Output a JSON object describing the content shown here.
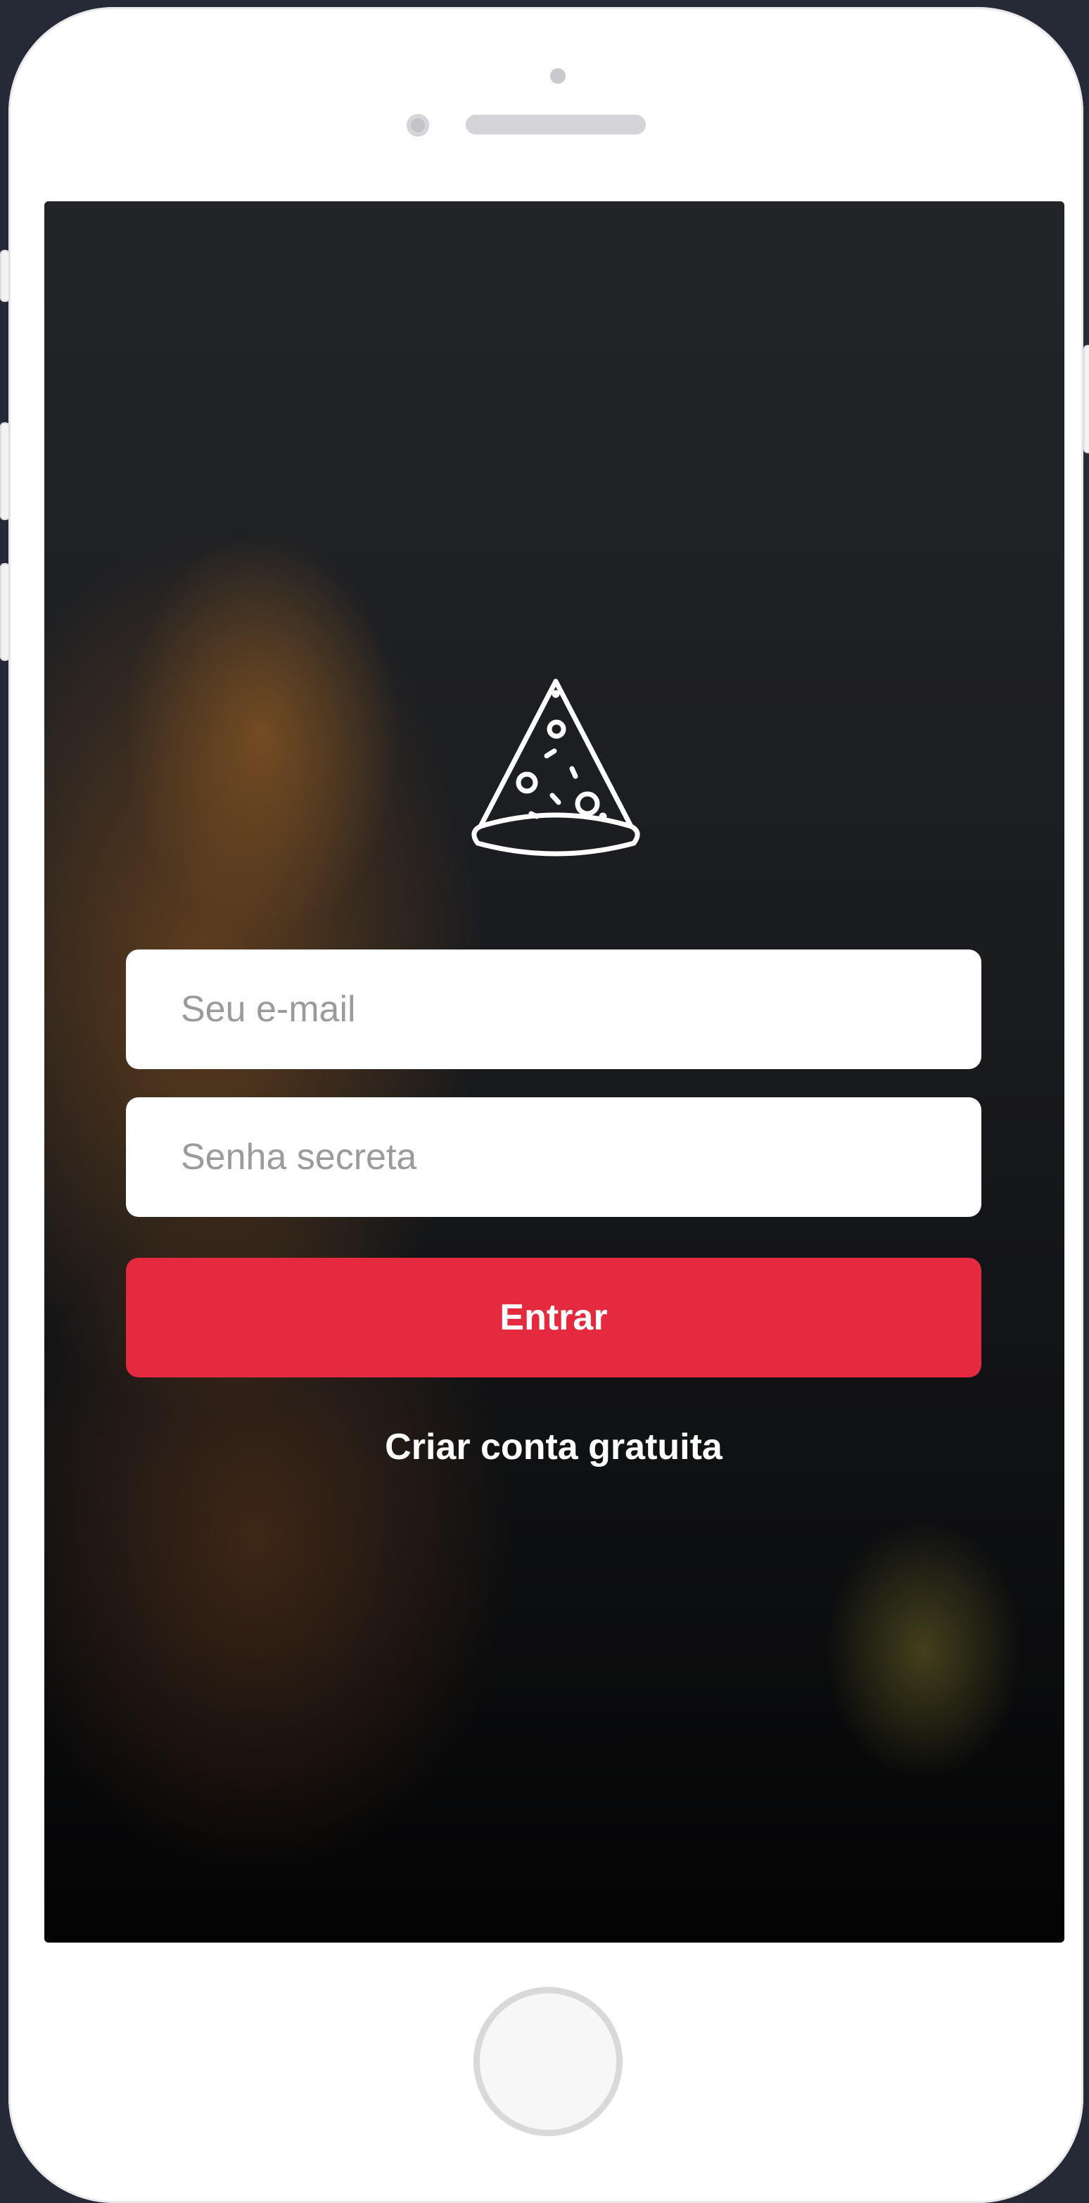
{
  "login": {
    "email_placeholder": "Seu e-mail",
    "password_placeholder": "Senha secreta",
    "submit_label": "Entrar",
    "signup_label": "Criar conta gratuita"
  },
  "logo": {
    "icon": "pizza-slice-icon",
    "color": "#ffffff"
  },
  "colors": {
    "accent": "#e52a3f",
    "device_frame": "#ffffff",
    "backdrop": "#262a36"
  }
}
